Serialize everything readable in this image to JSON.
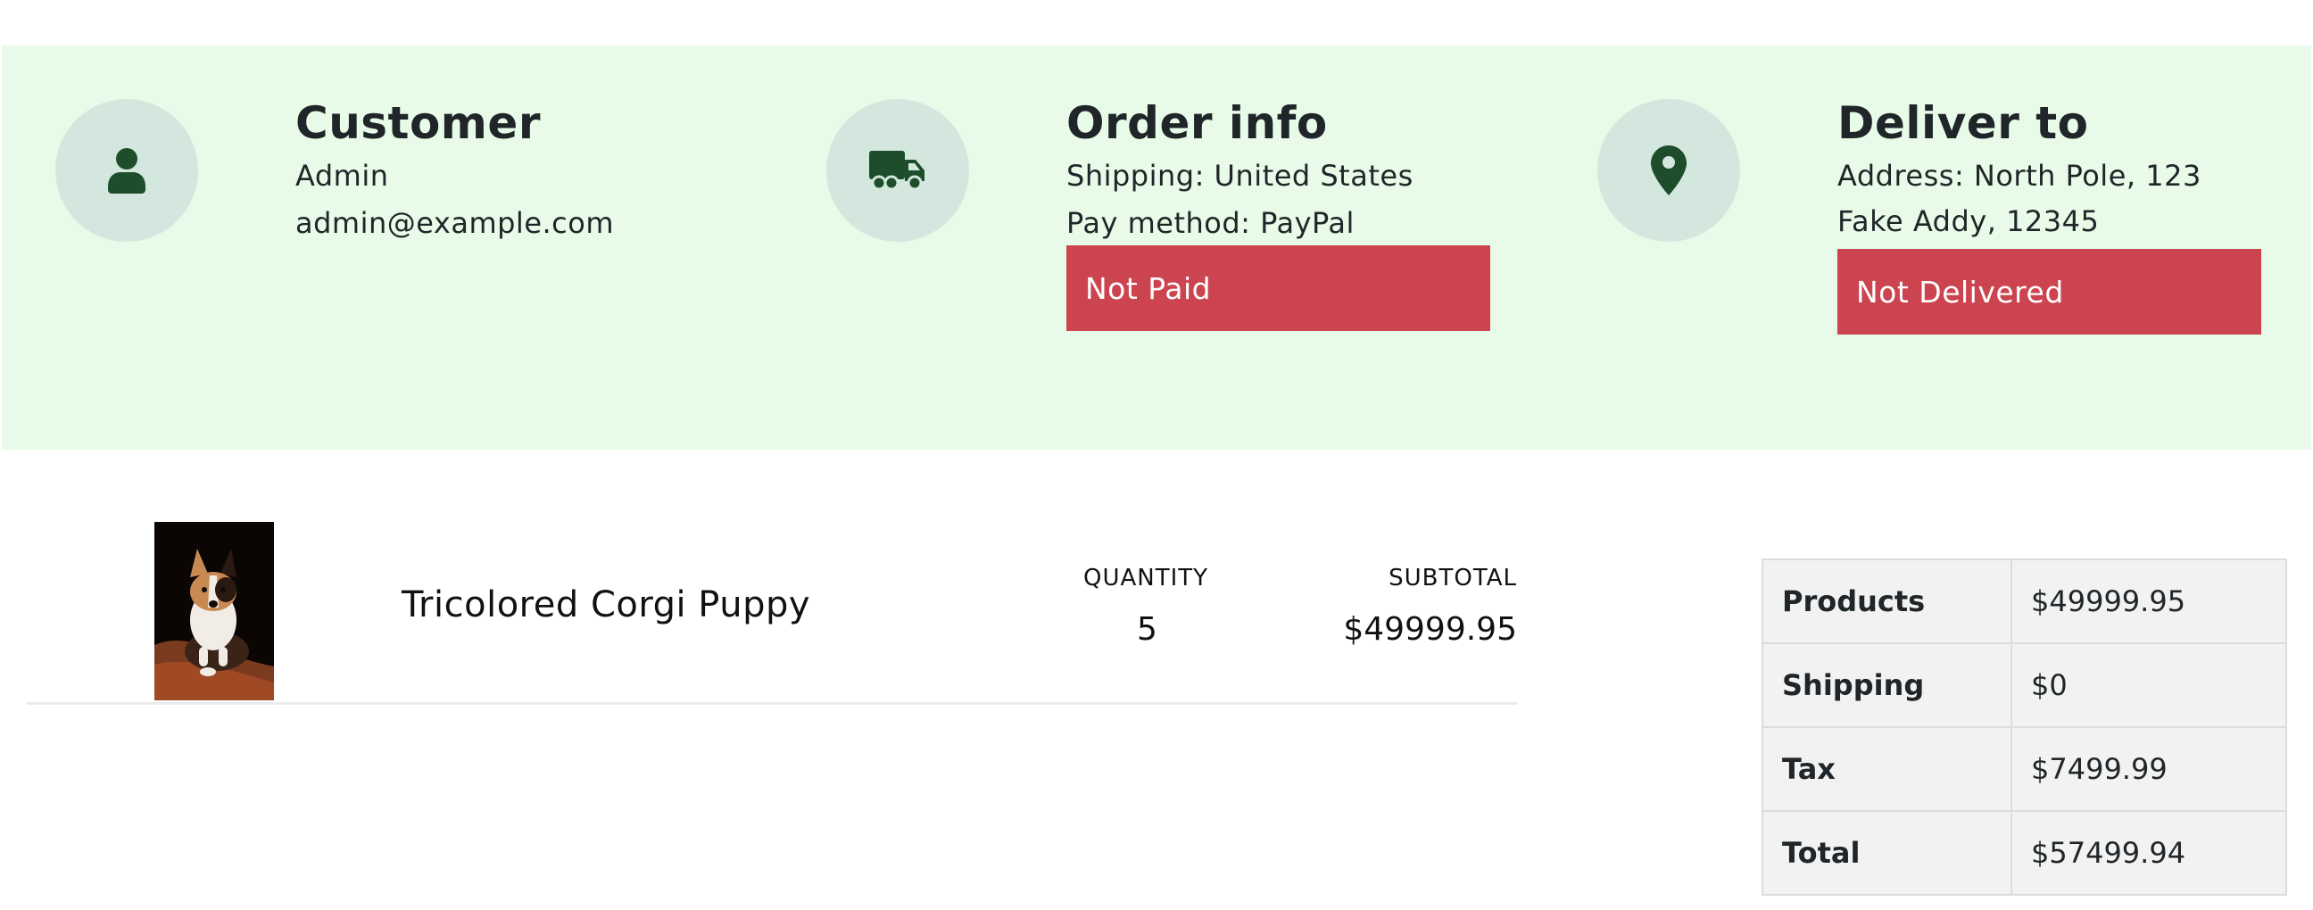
{
  "customer": {
    "title": "Customer",
    "name": "Admin",
    "email": "admin@example.com",
    "icon": "user-icon"
  },
  "order_info": {
    "title": "Order info",
    "shipping": "Shipping: United States",
    "pay_method": "Pay method: PayPal",
    "status": "Not Paid",
    "icon": "truck-icon"
  },
  "deliver_to": {
    "title": "Deliver to",
    "address": "Address: North Pole, 123 Fake Addy, 12345",
    "status": "Not Delivered",
    "icon": "map-marker-icon"
  },
  "item": {
    "name": "Tricolored Corgi Puppy",
    "quantity_label": "QUANTITY",
    "quantity": "5",
    "subtotal_label": "SUBTOTAL",
    "subtotal": "$49999.95"
  },
  "summary": [
    {
      "label": "Products",
      "value": "$49999.95"
    },
    {
      "label": "Shipping",
      "value": "$0"
    },
    {
      "label": "Tax",
      "value": "$7499.99"
    },
    {
      "label": "Total",
      "value": "$57499.94"
    }
  ],
  "colors": {
    "band_bg": "#e8fbe8",
    "icon_circle": "#d3e7df",
    "icon_fg": "#1e4d2b",
    "badge_red": "#cb444f"
  }
}
